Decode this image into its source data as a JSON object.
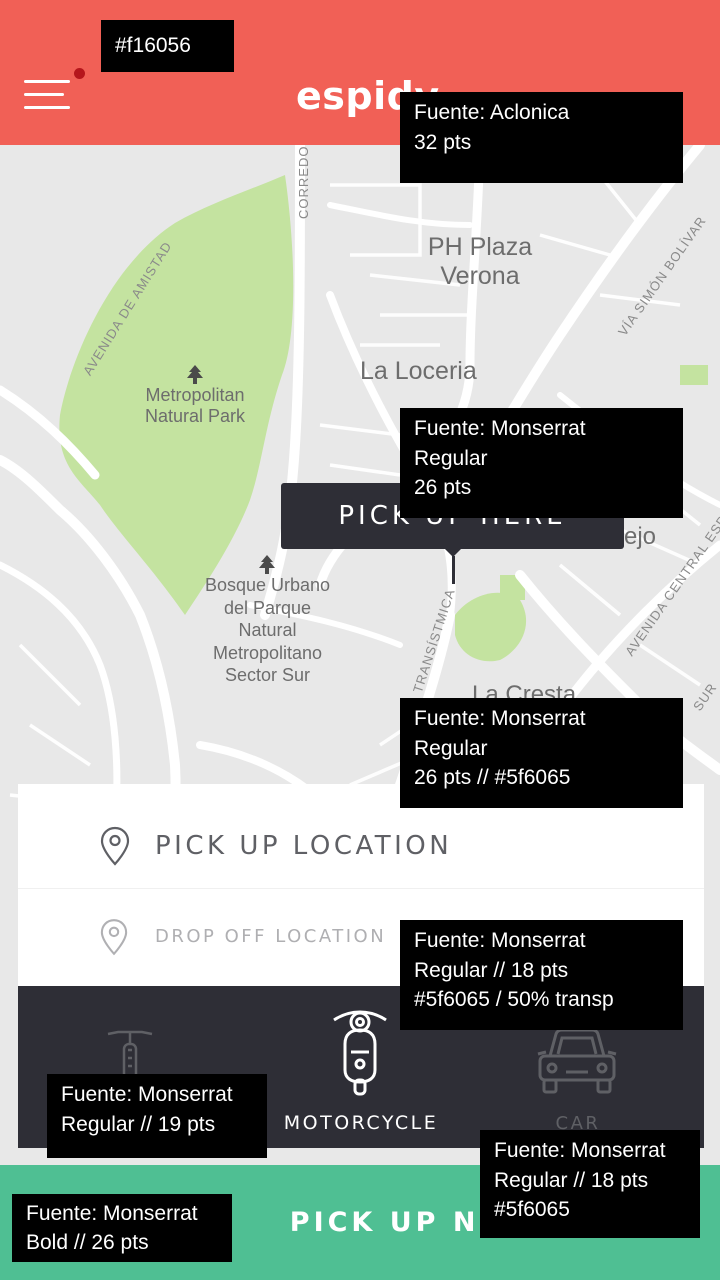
{
  "header": {
    "app_name": "espidy",
    "background_color": "#f16056",
    "menu_icon": "hamburger-menu-icon",
    "notification_dot_color": "#b5161c"
  },
  "map": {
    "places": {
      "ph_plaza": "PH Plaza\nVerona",
      "la_loceria": "La Loceria",
      "metropolitan_park": "Metropolitan\nNatural Park",
      "bosque": "Bosque Urbano\ndel Parque\nNatural\nMetropolitano\nSector Sur",
      "la_cresta": "La Cresta",
      "ejo": "rejo"
    },
    "streets": {
      "amistad": "AVENIDA DE AMISTAD",
      "corredor": "CORREDOR",
      "simon_bolivar": "VÍA SIMÓN BOLÍVAR",
      "transistmica": "TRANSÍSTMICA",
      "avenida_central": "AVENIDA CENTRAL ESPA",
      "sur": "SUR"
    },
    "park_icon": "tree-icon",
    "pin_tooltip": "PICK UP HERE"
  },
  "location_card": {
    "pickup": "PICK UP LOCATION",
    "dropoff": "DROP OFF LOCATION",
    "pin_icon": "location-pin-icon"
  },
  "vehicles": [
    {
      "label": "",
      "icon": "bicycle-icon",
      "active": false
    },
    {
      "label": "MOTORCYCLE",
      "icon": "scooter-icon",
      "active": true
    },
    {
      "label": "CAR",
      "icon": "car-icon",
      "active": false
    }
  ],
  "cta": {
    "label": "PICK UP NOW",
    "color": "#4fbf93"
  },
  "annotations": {
    "header_color": "#f16056",
    "logo_font": "Fuente: Aclonica\n32 pts",
    "tooltip_font": "Fuente: Monserrat\nRegular\n26 pts",
    "pickup_font": "Fuente: Monserrat\nRegular\n26 pts  // #5f6065",
    "dropoff_font": "Fuente: Monserrat\nRegular  //  18 pts\n#5f6065  /  50% transp",
    "moto_font": "Fuente: Monserrat\nRegular  //  19 pts",
    "car_font": "Fuente: Monserrat\nRegular  //  18 pts\n#5f6065",
    "cta_font": "Fuente: Monserrat\nBold  //  26 pts"
  }
}
